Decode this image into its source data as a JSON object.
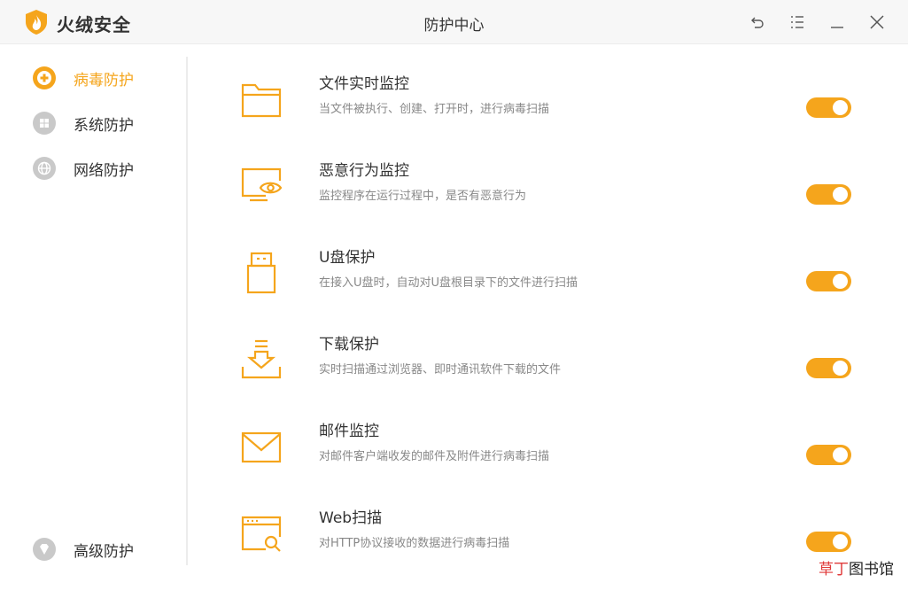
{
  "app": {
    "brand": "火绒安全",
    "window_title": "防护中心",
    "accent_color": "#f5a51c"
  },
  "titlebar": {
    "buttons": [
      "back-icon",
      "menu-icon",
      "minimize-icon",
      "close-icon"
    ]
  },
  "sidebar": {
    "items": [
      {
        "label": "病毒防护",
        "icon": "virus-shield-icon",
        "active": true
      },
      {
        "label": "系统防护",
        "icon": "windows-icon",
        "active": false
      },
      {
        "label": "网络防护",
        "icon": "globe-icon",
        "active": false
      }
    ],
    "bottom_item": {
      "label": "高级防护",
      "icon": "diamond-icon"
    }
  },
  "features": [
    {
      "title": "文件实时监控",
      "desc": "当文件被执行、创建、打开时，进行病毒扫描",
      "icon": "folder-icon",
      "enabled": true
    },
    {
      "title": "恶意行为监控",
      "desc": "监控程序在运行过程中，是否有恶意行为",
      "icon": "monitor-eye-icon",
      "enabled": true
    },
    {
      "title": "U盘保护",
      "desc": "在接入U盘时，自动对U盘根目录下的文件进行扫描",
      "icon": "usb-drive-icon",
      "enabled": true
    },
    {
      "title": "下载保护",
      "desc": "实时扫描通过浏览器、即时通讯软件下载的文件",
      "icon": "download-icon",
      "enabled": true
    },
    {
      "title": "邮件监控",
      "desc": "对邮件客户端收发的邮件及附件进行病毒扫描",
      "icon": "mail-icon",
      "enabled": true
    },
    {
      "title": "Web扫描",
      "desc": "对HTTP协议接收的数据进行病毒扫描",
      "icon": "web-scan-icon",
      "enabled": true
    }
  ],
  "watermark": {
    "part1": "草丁",
    "part2": "图书馆"
  }
}
